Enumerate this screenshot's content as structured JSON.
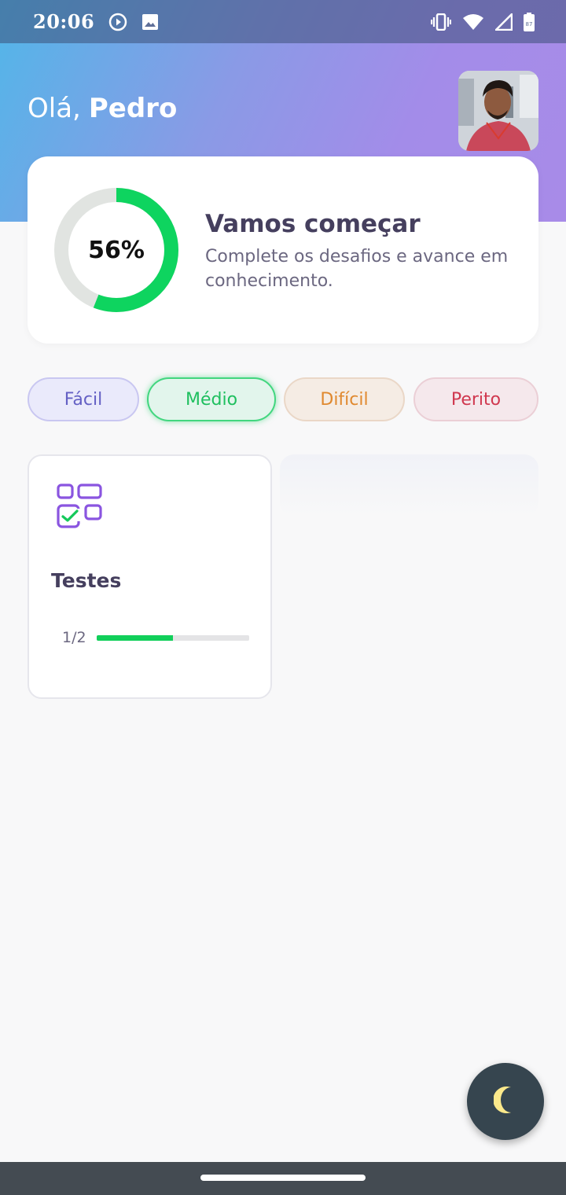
{
  "status_bar": {
    "time": "20:06",
    "left_icons": [
      "media-play-icon",
      "image-icon"
    ],
    "right_icons": [
      "vibrate-icon",
      "wifi-icon",
      "signal-icon",
      "battery-icon"
    ],
    "battery_level": "87"
  },
  "header": {
    "greeting": "Olá,",
    "user_name": "Pedro",
    "gradient_colors": [
      "#52b6e8",
      "#a88be8"
    ]
  },
  "progress_card": {
    "percent": 56,
    "percent_label": "56%",
    "title": "Vamos começar",
    "subtitle": "Complete os desafios e avance em conhecimento.",
    "ring_color": "#0ed45f",
    "track_color": "#e1e4e1"
  },
  "levels": [
    {
      "label": "Fácil",
      "selected": false,
      "color": "#6460c4"
    },
    {
      "label": "Médio",
      "selected": true,
      "color": "#1fbf5f"
    },
    {
      "label": "Difícil",
      "selected": false,
      "color": "#e0892f"
    },
    {
      "label": "Perito",
      "selected": false,
      "color": "#d0384f"
    }
  ],
  "topics": [
    {
      "name": "Testes",
      "icon": "tests-checklist-icon",
      "completed": 1,
      "total": 2,
      "count_label": "1/2",
      "progress": 0.5
    }
  ],
  "theme_toggle": {
    "icon": "moon-icon",
    "icon_color": "#fce98b"
  }
}
